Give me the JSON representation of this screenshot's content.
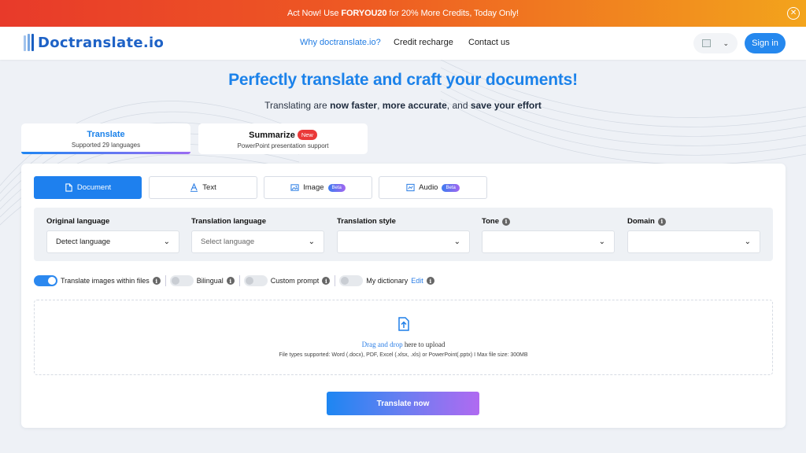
{
  "promo": {
    "prefix": "Act Now! Use ",
    "code": "FORYOU20",
    "suffix": " for 20% More Credits, Today Only!",
    "close_icon": "close-icon"
  },
  "nav": {
    "logo_text": "Doctranslate.io",
    "links": [
      "Why doctranslate.io?",
      "Credit recharge",
      "Contact us"
    ],
    "sign_in": "Sign in",
    "lang_icon": "flag-icon"
  },
  "hero": {
    "title": "Perfectly translate and craft your documents!",
    "sub_a": "Translating are ",
    "sub_b": "now faster",
    "sub_c": ", ",
    "sub_d": "more accurate",
    "sub_e": ", and ",
    "sub_f": "save your effort"
  },
  "modes": [
    {
      "title": "Translate",
      "subtitle": "Supported 29 languages"
    },
    {
      "title": "Summarize",
      "badge": "New",
      "subtitle": "PowerPoint presentation support"
    }
  ],
  "types": [
    {
      "label": "Document",
      "icon": "document-icon"
    },
    {
      "label": "Text",
      "icon": "text-icon"
    },
    {
      "label": "Image",
      "icon": "image-icon",
      "badge": "Beta"
    },
    {
      "label": "Audio",
      "icon": "audio-icon",
      "badge": "Beta"
    }
  ],
  "fields": [
    {
      "label": "Original language",
      "value": "Detect language"
    },
    {
      "label": "Translation language",
      "placeholder": "Select language"
    },
    {
      "label": "Translation style",
      "value": ""
    },
    {
      "label": "Tone",
      "value": ""
    },
    {
      "label": "Domain",
      "value": ""
    }
  ],
  "options": [
    {
      "label": "Translate images within files",
      "on": true
    },
    {
      "label": "Bilingual",
      "on": false
    },
    {
      "label": "Custom prompt",
      "on": false
    },
    {
      "label": "My dictionary",
      "on": false,
      "link": "Edit"
    }
  ],
  "upload": {
    "link": "Drag and drop",
    "rest": " here to upload",
    "types": "File types supported: Word (.docx), PDF, Excel (.xlsx, .xls) or PowerPoint(.pptx) I Max file size: 300MB"
  },
  "cta": "Translate now",
  "colors": {
    "accent": "#1e80ee",
    "promo_start": "#e83a2a",
    "promo_end": "#f3a41c",
    "badge_new": "#ea3939"
  }
}
